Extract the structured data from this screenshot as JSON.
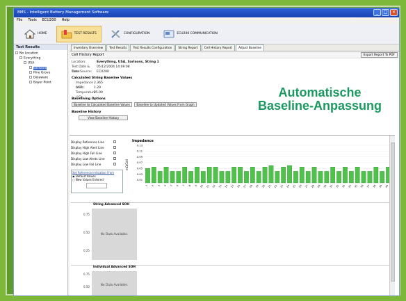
{
  "window": {
    "title": "BMS - Intelligent Battery Management Software"
  },
  "menu": [
    "File",
    "Tools",
    "ECU200",
    "Help"
  ],
  "toolbar": [
    {
      "label": "HOME",
      "icon": "home-icon",
      "active": false
    },
    {
      "label": "TEST RESULTS",
      "icon": "folder-icon",
      "active": true
    },
    {
      "label": "CONFIGURATION",
      "icon": "tools-icon",
      "active": false
    },
    {
      "label": "ECU200 COMMUNICATION",
      "icon": "device-icon",
      "active": false
    }
  ],
  "left": {
    "header": "Test Results",
    "tree": [
      "No Location",
      "Everything",
      "USA",
      "Sarlsons",
      "Pine Grove",
      "Delaware",
      "Bayer Point"
    ]
  },
  "tabs": [
    "Inventory Overview",
    "Test Results",
    "Test Results Configuration",
    "String Report",
    "Cell History Report",
    "Adjust Baseline"
  ],
  "active_tab": 5,
  "report": {
    "title": "Cell History Report",
    "export": "Export Report To PDF"
  },
  "info": {
    "location_k": "Location:",
    "location_v": "Everything, USA, Sarlsons, String 1",
    "date_k": "Test Date & Time:",
    "date_v": "05/12/2004 14:09:08",
    "source_k": "Data Source:",
    "source_v": "ECU200",
    "calc_title": "Calculated String Baseline Values",
    "imp_k": "Impedance (mΩ):",
    "imp_v": "2.365",
    "acr_k": "ACP:",
    "acr_v": "1.29",
    "temp_k": "Temperature (°C):",
    "temp_v": "25.00",
    "baseline_opts": "Baselining Options",
    "btn1": "Baseline to Calculated Baseline Values",
    "btn2": "Baseline to Updated Values From Graph",
    "history_title": "Baseline History",
    "btn3": "View Baseline History"
  },
  "headline": {
    "line1": "Automatische",
    "line2": "Baseline-Anpassung"
  },
  "options": {
    "items": [
      "Display Reference Line",
      "Display High Alert Line",
      "Display High Fail Line",
      "Display Low Alerts Line",
      "Display Low Fail Line"
    ],
    "box_title": "Set Reference Indication From",
    "radio1": "Default Values",
    "radio2": "New Values Entered"
  },
  "impedance_chart": {
    "title": "Impedance",
    "ylabel": "mΩ/Cell"
  },
  "sub1": {
    "title": "String Advanced SOH",
    "message": "No Data Available."
  },
  "sub2": {
    "title": "Individual Advanced SOH",
    "message": "No Data Available."
  },
  "colors": {
    "bar": "#4fc24a",
    "bar_edge": "#2a7a2a",
    "accent": "#1c9960"
  },
  "chart_data": {
    "type": "bar",
    "title": "Impedance",
    "ylabel": "mΩ/Cell",
    "ylim": [
      0,
      0.13
    ],
    "categories": [
      "1",
      "2",
      "3",
      "4",
      "5",
      "6",
      "7",
      "8",
      "9",
      "10",
      "11",
      "12",
      "13",
      "14",
      "15",
      "16",
      "17",
      "18",
      "19",
      "20",
      "21",
      "22",
      "23",
      "24",
      "25",
      "26",
      "27",
      "28",
      "29",
      "30",
      "31",
      "32",
      "33",
      "34",
      "35",
      "36",
      "37",
      "38",
      "39",
      "40"
    ],
    "values": [
      0.05,
      0.055,
      0.04,
      0.055,
      0.04,
      0.04,
      0.055,
      0.04,
      0.055,
      0.04,
      0.055,
      0.055,
      0.04,
      0.04,
      0.055,
      0.055,
      0.04,
      0.055,
      0.04,
      0.055,
      0.06,
      0.04,
      0.055,
      0.06,
      0.04,
      0.055,
      0.04,
      0.055,
      0.04,
      0.04,
      0.055,
      0.04,
      0.055,
      0.04,
      0.055,
      0.04,
      0.04,
      0.055,
      0.04,
      0.055
    ]
  }
}
